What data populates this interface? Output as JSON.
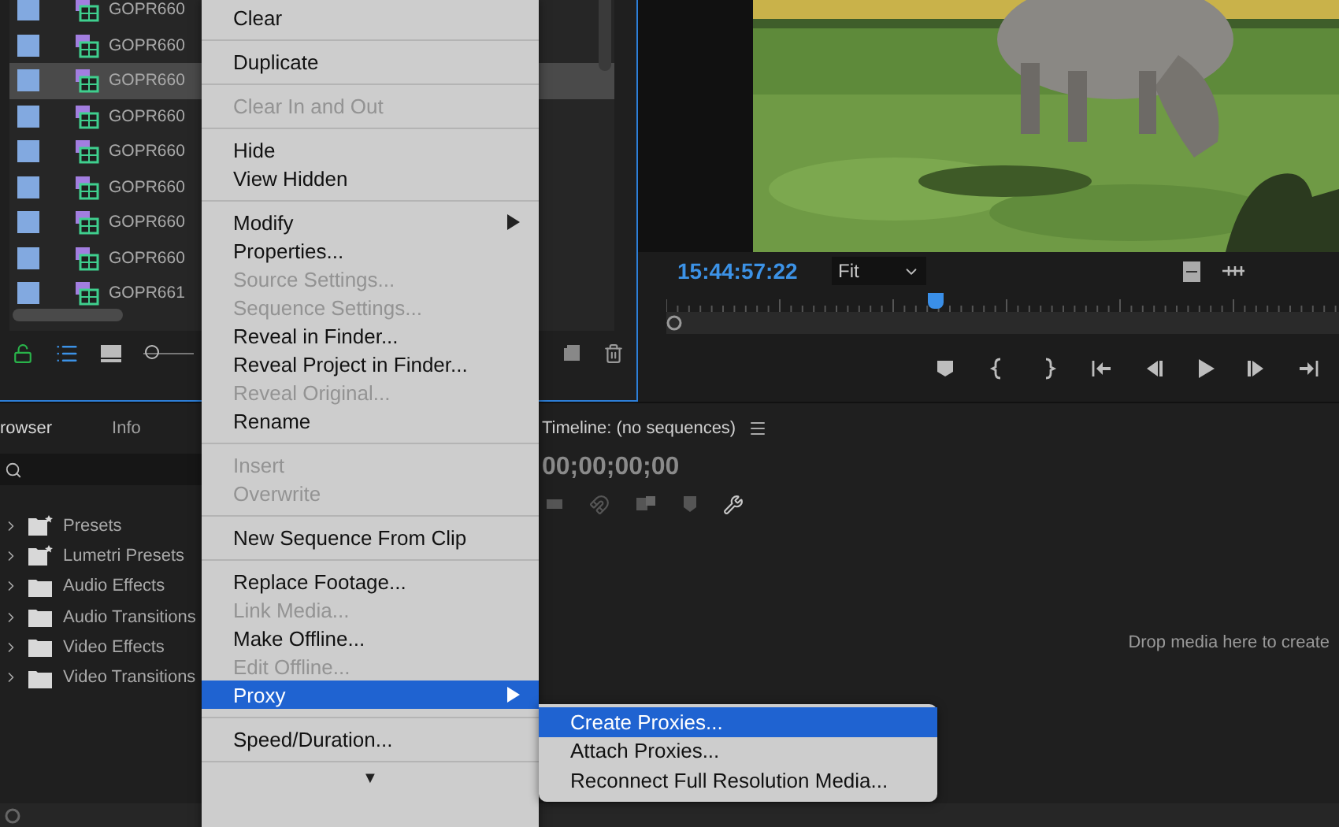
{
  "project_panel": {
    "clips": [
      {
        "name": "GOPR660",
        "selected": false
      },
      {
        "name": "GOPR660",
        "selected": false
      },
      {
        "name": "GOPR660",
        "selected": true
      },
      {
        "name": "GOPR660",
        "selected": false
      },
      {
        "name": "GOPR660",
        "selected": false
      },
      {
        "name": "GOPR660",
        "selected": false
      },
      {
        "name": "GOPR660",
        "selected": false
      },
      {
        "name": "GOPR660",
        "selected": false
      },
      {
        "name": "GOPR661",
        "selected": false
      }
    ],
    "zoom_slider": {
      "level": 0.05
    }
  },
  "source_monitor": {
    "timecode": "15:44:57:22",
    "zoom": "Fit",
    "playhead": {
      "level": 0.4
    }
  },
  "effects_panel": {
    "tabs": [
      {
        "label": "rowser",
        "selected": true
      },
      {
        "label": "Info",
        "selected": false
      }
    ],
    "items": [
      {
        "label": "Presets",
        "kind": "preset-folder"
      },
      {
        "label": "Lumetri Presets",
        "kind": "preset-folder"
      },
      {
        "label": "Audio Effects",
        "kind": "folder"
      },
      {
        "label": "Audio Transitions",
        "kind": "folder"
      },
      {
        "label": "Video Effects",
        "kind": "folder"
      },
      {
        "label": "Video Transitions",
        "kind": "folder"
      }
    ]
  },
  "timeline": {
    "title": "Timeline: (no sequences)",
    "timecode": "00;00;00;00",
    "empty_message": "Drop media here to create"
  },
  "context_menu": {
    "groups": [
      {
        "items": [
          {
            "label": "Clear",
            "disabled": false,
            "selected": false,
            "submenu": false
          }
        ]
      },
      {
        "items": [
          {
            "label": "Duplicate",
            "disabled": false,
            "selected": false,
            "submenu": false
          }
        ]
      },
      {
        "items": [
          {
            "label": "Clear In and Out",
            "disabled": true,
            "selected": false,
            "submenu": false
          }
        ]
      },
      {
        "items": [
          {
            "label": "Hide",
            "disabled": false,
            "selected": false,
            "submenu": false
          },
          {
            "label": "View Hidden",
            "disabled": false,
            "selected": false,
            "submenu": false
          }
        ]
      },
      {
        "items": [
          {
            "label": "Modify",
            "disabled": false,
            "selected": false,
            "submenu": true
          },
          {
            "label": "Properties...",
            "disabled": false,
            "selected": false,
            "submenu": false
          },
          {
            "label": "Source Settings...",
            "disabled": true,
            "selected": false,
            "submenu": false
          },
          {
            "label": "Sequence Settings...",
            "disabled": true,
            "selected": false,
            "submenu": false
          },
          {
            "label": "Reveal in Finder...",
            "disabled": false,
            "selected": false,
            "submenu": false
          },
          {
            "label": "Reveal Project in Finder...",
            "disabled": false,
            "selected": false,
            "submenu": false
          },
          {
            "label": "Reveal Original...",
            "disabled": true,
            "selected": false,
            "submenu": false
          },
          {
            "label": "Rename",
            "disabled": false,
            "selected": false,
            "submenu": false
          }
        ]
      },
      {
        "items": [
          {
            "label": "Insert",
            "disabled": true,
            "selected": false,
            "submenu": false
          },
          {
            "label": "Overwrite",
            "disabled": true,
            "selected": false,
            "submenu": false
          }
        ]
      },
      {
        "items": [
          {
            "label": "New Sequence From Clip",
            "disabled": false,
            "selected": false,
            "submenu": false
          }
        ]
      },
      {
        "items": [
          {
            "label": "Replace Footage...",
            "disabled": false,
            "selected": false,
            "submenu": false
          },
          {
            "label": "Link Media...",
            "disabled": true,
            "selected": false,
            "submenu": false
          },
          {
            "label": "Make Offline...",
            "disabled": false,
            "selected": false,
            "submenu": false
          },
          {
            "label": "Edit Offline...",
            "disabled": true,
            "selected": false,
            "submenu": false
          },
          {
            "label": "Proxy",
            "disabled": false,
            "selected": true,
            "submenu": true
          }
        ]
      },
      {
        "items": [
          {
            "label": "Speed/Duration...",
            "disabled": false,
            "selected": false,
            "submenu": false
          }
        ]
      }
    ],
    "more_indicator": "▼"
  },
  "submenu": {
    "items": [
      {
        "label": "Create Proxies...",
        "selected": true
      },
      {
        "label": "Attach Proxies...",
        "selected": false
      },
      {
        "label": "Reconnect Full Resolution Media...",
        "selected": false
      }
    ]
  }
}
